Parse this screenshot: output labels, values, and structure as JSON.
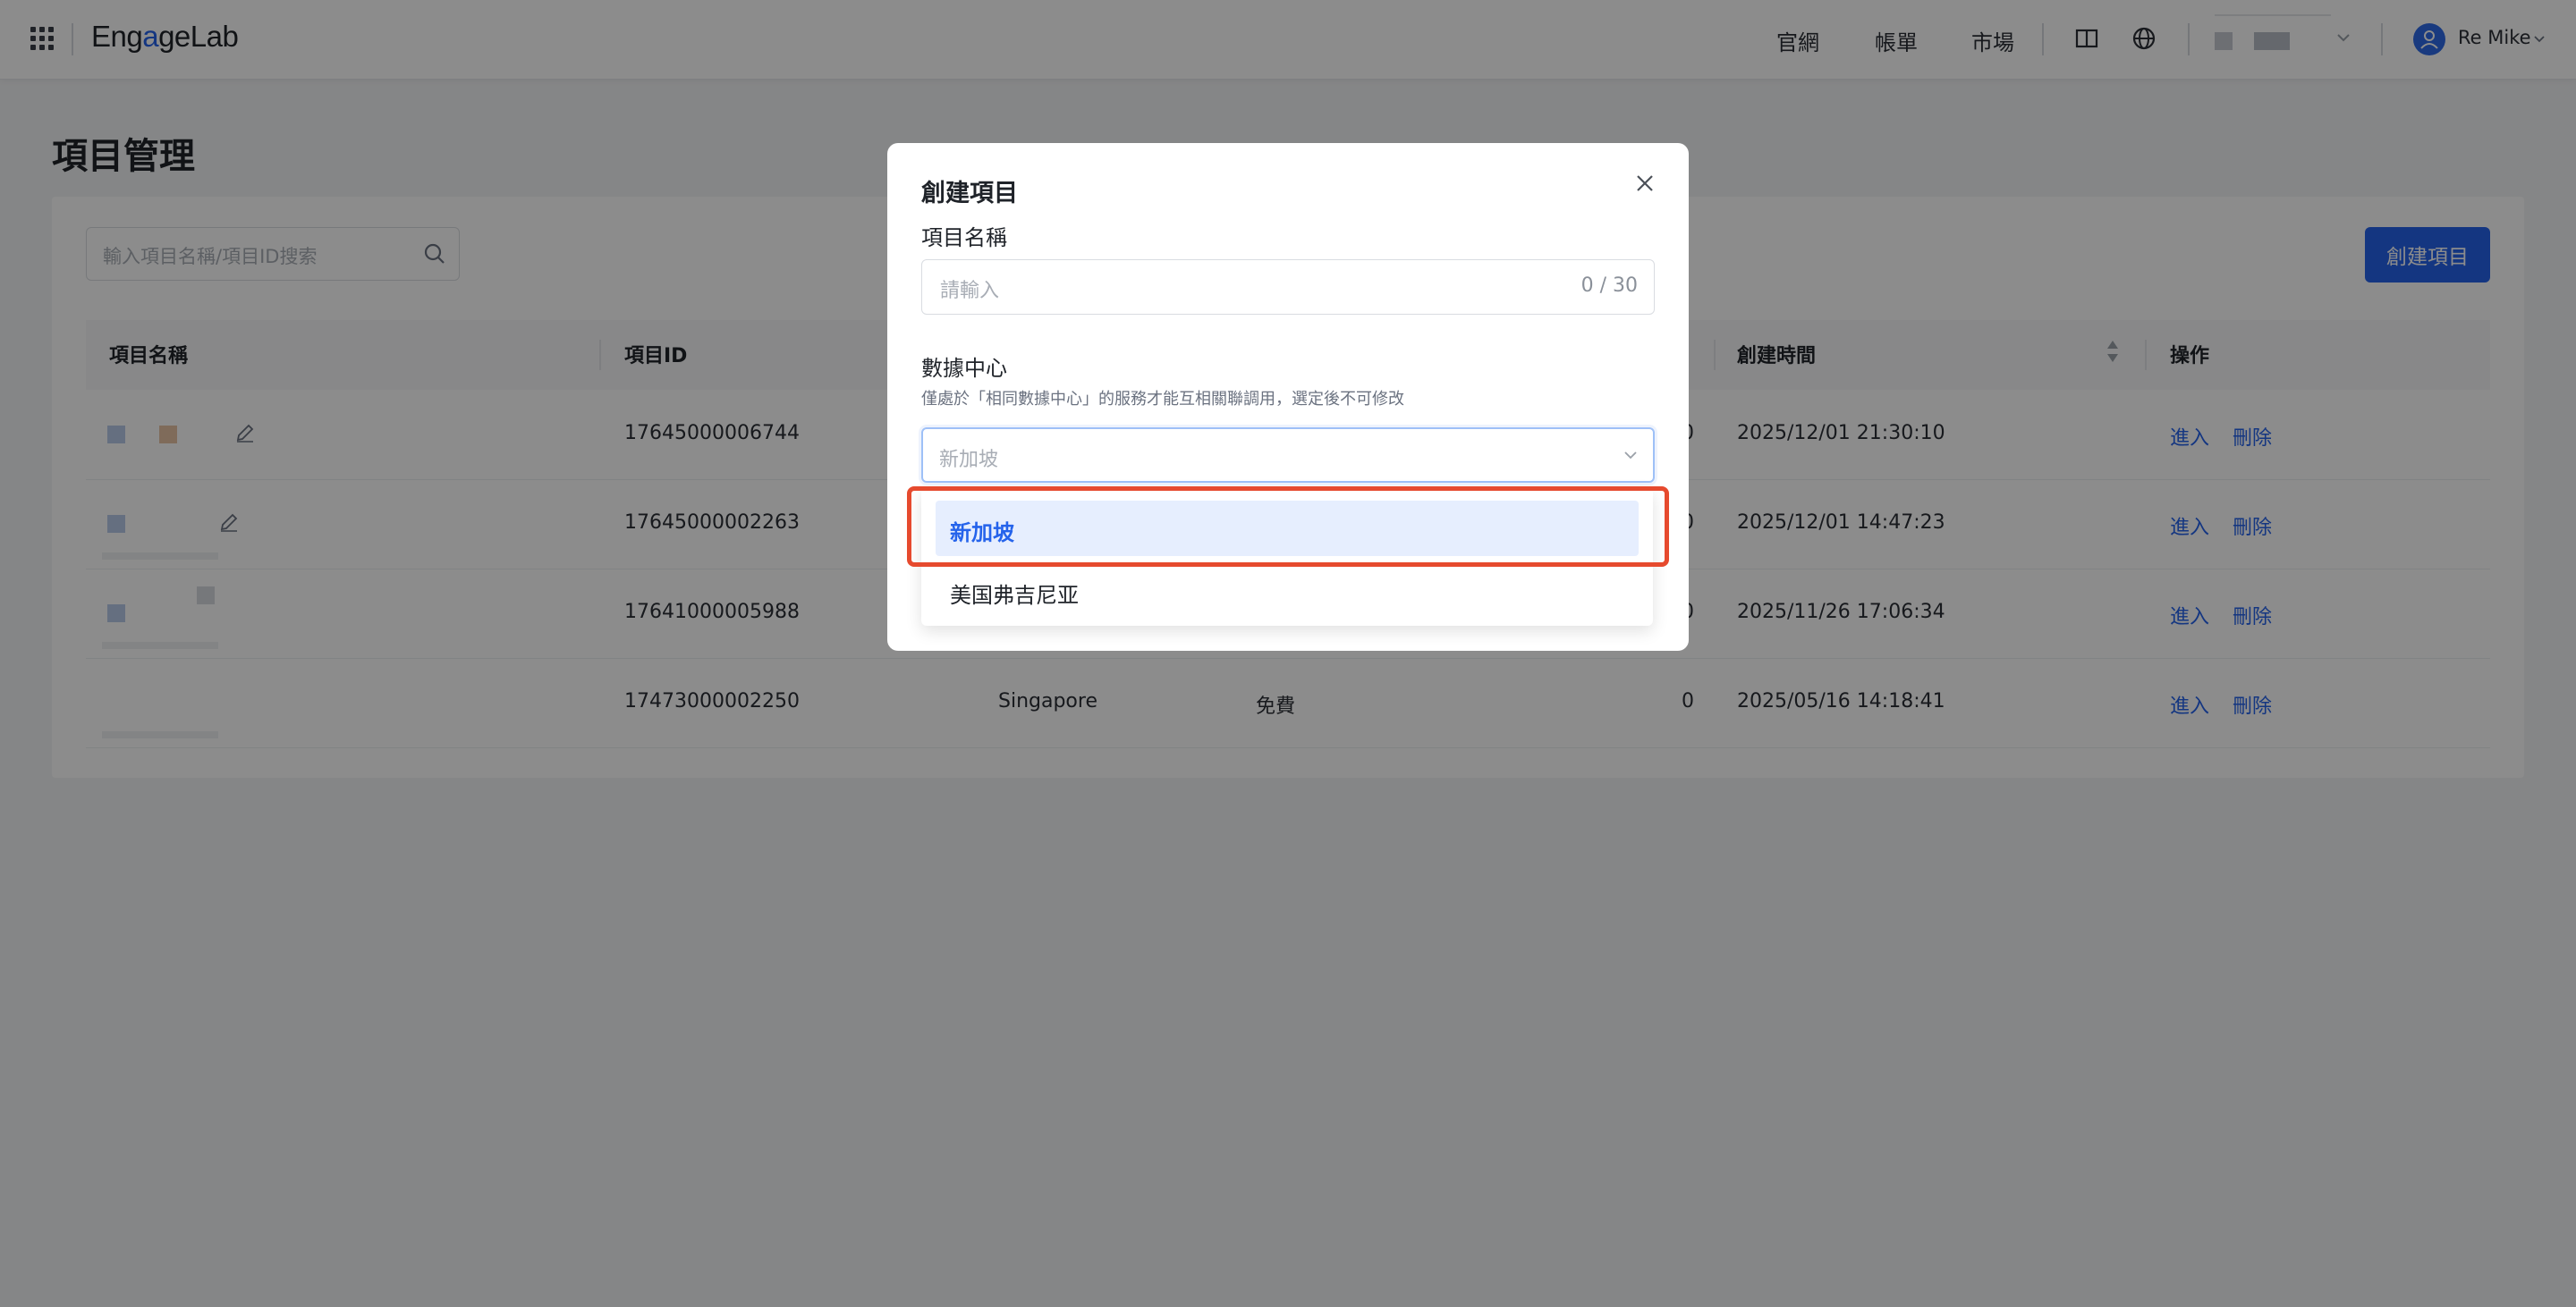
{
  "app": {
    "logo_left": "Eng",
    "logo_dot": "a",
    "logo_right": "geLab"
  },
  "nav": {
    "official": "官網",
    "billing": "帳單",
    "market": "市場",
    "user_name": "Re Mike"
  },
  "page": {
    "title": "項目管理",
    "search_placeholder": "輸入項目名稱/項目ID搜索",
    "create_button": "創建項目"
  },
  "table": {
    "columns": {
      "name": "項目名稱",
      "id": "項目ID",
      "created": "創建時間",
      "actions": "操作"
    },
    "rows": [
      {
        "id": "17645000006744",
        "region": "",
        "plan": "",
        "count": "0",
        "created": "2025/12/01 21:30:10",
        "enter": "進入",
        "delete": "刪除"
      },
      {
        "id": "17645000002263",
        "region": "",
        "plan": "",
        "count": "0",
        "created": "2025/12/01 14:47:23",
        "enter": "進入",
        "delete": "刪除"
      },
      {
        "id": "17641000005988",
        "region": "",
        "plan": "",
        "count": "0",
        "created": "2025/11/26 17:06:34",
        "enter": "進入",
        "delete": "刪除"
      },
      {
        "id": "17473000002250",
        "region": "Singapore",
        "plan": "免費",
        "count": "0",
        "created": "2025/05/16 14:18:41",
        "enter": "進入",
        "delete": "刪除"
      }
    ]
  },
  "modal": {
    "title": "創建項目",
    "name_label": "項目名稱",
    "name_placeholder": "請輸入",
    "name_counter": "0 / 30",
    "dc_label": "數據中心",
    "dc_hint": "僅處於「相同數據中心」的服務才能互相關聯調用，選定後不可修改",
    "dc_value": "新加坡",
    "options": [
      "新加坡",
      "美国弗吉尼亚"
    ]
  }
}
